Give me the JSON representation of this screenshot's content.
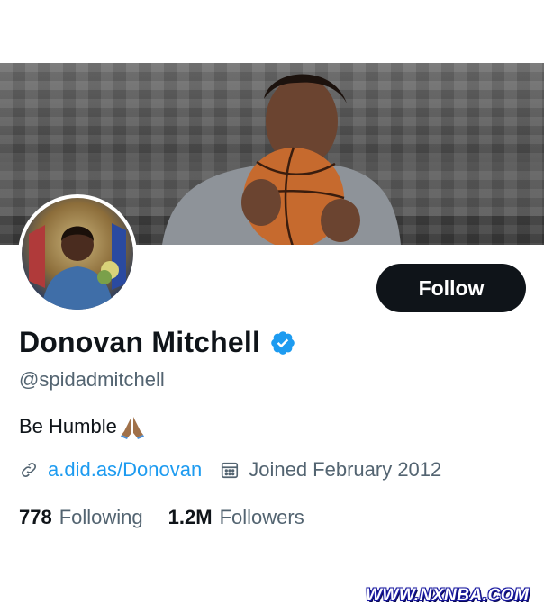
{
  "profile": {
    "display_name": "Donovan Mitchell",
    "handle": "@spidadmitchell",
    "bio_text": "Be Humble",
    "bio_emoji": "folded-hands-icon",
    "link_text": "a.did.as/Donovan",
    "joined_text": "Joined February 2012",
    "verified_icon": "verified-badge-icon"
  },
  "actions": {
    "follow_label": "Follow"
  },
  "stats": {
    "following_count": "778",
    "following_label": "Following",
    "followers_count": "1.2M",
    "followers_label": "Followers"
  },
  "watermark": {
    "text": "WWW.NXNBA.COM"
  },
  "colors": {
    "accent": "#1d9bf0",
    "text_primary": "#0f1419",
    "text_secondary": "#536471",
    "button_bg": "#0f1419"
  }
}
